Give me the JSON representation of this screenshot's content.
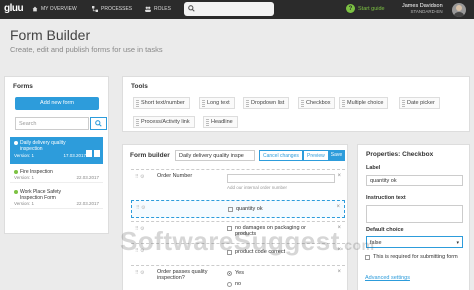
{
  "topbar": {
    "logo": "gluu",
    "nav": [
      {
        "label": "MY OVERVIEW",
        "icon": "home-icon"
      },
      {
        "label": "PROCESSES",
        "icon": "flowchart-icon"
      },
      {
        "label": "ROLES",
        "icon": "users-icon"
      }
    ],
    "start_guide": "Start guide",
    "user_name": "James Davidson",
    "user_role": "STANDARD-EN"
  },
  "page": {
    "title": "Form Builder",
    "subtitle": "Create, edit and publish forms for use in tasks"
  },
  "forms_panel": {
    "title": "Forms",
    "new_form": "Add new form",
    "search_placeholder": "Search",
    "items": [
      {
        "name": "Daily delivery quality inspection",
        "version": "Version: 1",
        "date": "17.03.2017",
        "status_color": "#7cc242"
      },
      {
        "name": "Fire Inspection",
        "version": "Version: 1",
        "date": "22.03.2017",
        "status_color": "#7cc242"
      },
      {
        "name": "Work Place Safety Inspection Form",
        "version": "Version: 1",
        "date": "22.03.2017",
        "status_color": "#7cc242"
      }
    ]
  },
  "tools": {
    "title": "Tools",
    "items": [
      "Short text/number",
      "Long text",
      "Dropdown list",
      "Checkbox",
      "Multiple choice",
      "Date picker",
      "Process/Activity link",
      "Headline"
    ]
  },
  "form_builder": {
    "title": "Form builder",
    "form_name": "Daily delivery quality inspe",
    "cancel": "Cancel changes",
    "preview": "Preview",
    "save": "Save",
    "fields": {
      "order_number": "Order Number",
      "order_hint": "Add our internal order number",
      "quantity_ok": "quantity ok",
      "no_damages": "no damages on packaging or products",
      "product_correct": "product code correct",
      "order_passes": "Order passes quality inspection?",
      "yes": "Yes",
      "no": "no"
    }
  },
  "properties": {
    "title": "Properties: Checkbox",
    "label_title": "Label",
    "label_value": "quantity ok",
    "instruction_title": "Instruction text",
    "default_title": "Default choice",
    "default_value": "false",
    "required_text": "This is required for submitting form",
    "advanced": "Advanced settings"
  },
  "watermark": {
    "main": "SoftwareSuggest",
    "suffix": ".com"
  },
  "colors": {
    "accent": "#2d9cdb",
    "topbar": "#2b2b2b",
    "green": "#7cc242"
  }
}
